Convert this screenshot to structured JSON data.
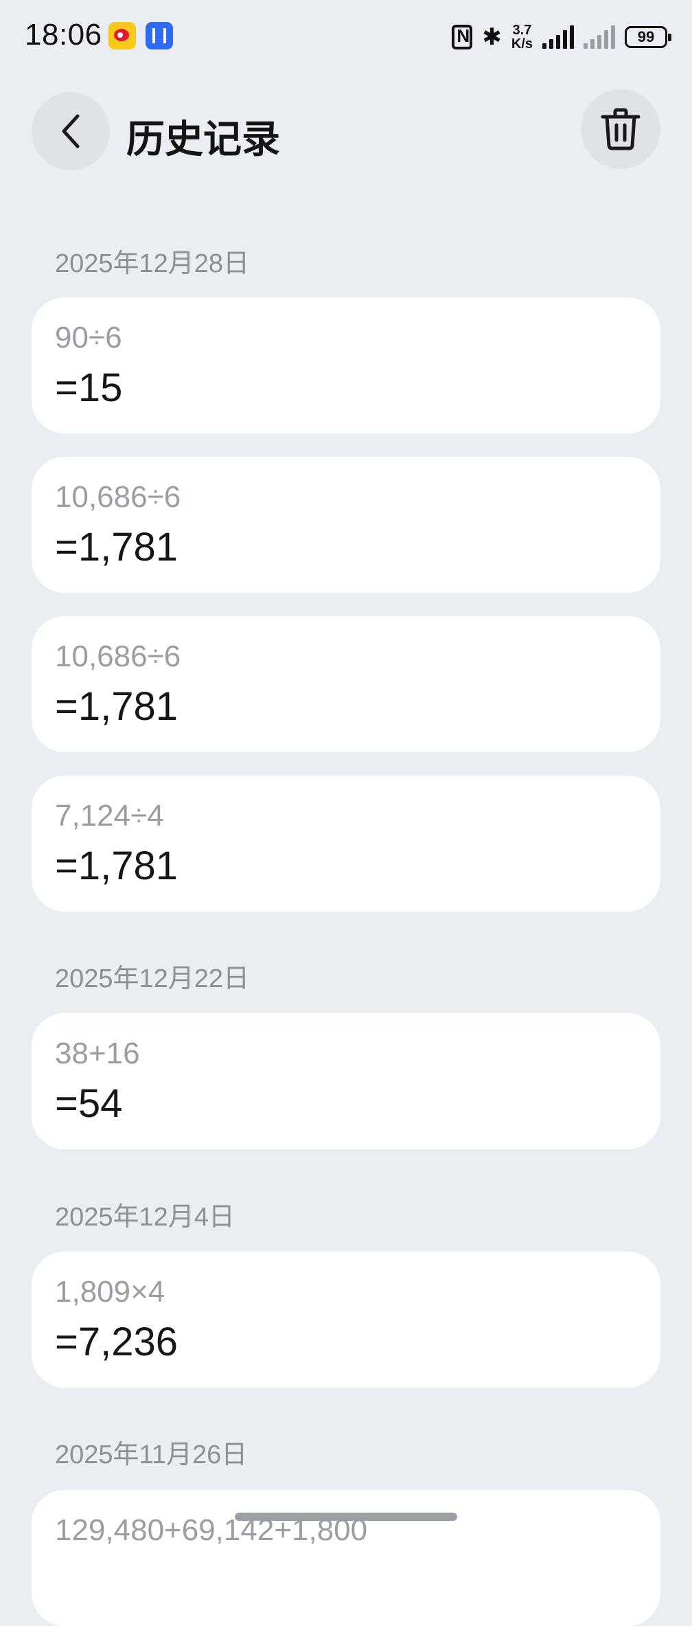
{
  "status_bar": {
    "time": "18:06",
    "net_speed_value": "3.7",
    "net_speed_unit": "K/s",
    "battery": "99",
    "icons": [
      "weibo-app-icon",
      "hongmeng-app-icon",
      "nfc-icon",
      "bluetooth-icon",
      "signal-icon",
      "signal-no-service-icon",
      "battery-icon"
    ]
  },
  "header": {
    "title": "历史记录",
    "back_icon": "chevron-left-icon",
    "trash_icon": "trash-icon"
  },
  "groups": [
    {
      "date": "2025年12月28日",
      "items": [
        {
          "expression": "90÷6",
          "result": "=15"
        },
        {
          "expression": "10,686÷6",
          "result": "=1,781"
        },
        {
          "expression": "10,686÷6",
          "result": "=1,781"
        },
        {
          "expression": "7,124÷4",
          "result": "=1,781"
        }
      ]
    },
    {
      "date": "2025年12月22日",
      "items": [
        {
          "expression": "38+16",
          "result": "=54"
        }
      ]
    },
    {
      "date": "2025年12月4日",
      "items": [
        {
          "expression": "1,809×4",
          "result": "=7,236"
        }
      ]
    },
    {
      "date": "2025年11月26日",
      "items": [
        {
          "expression": "129,480+69,142+1,800",
          "result": ""
        }
      ]
    }
  ]
}
